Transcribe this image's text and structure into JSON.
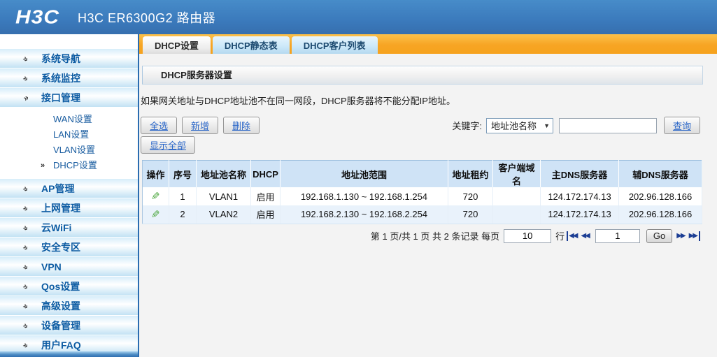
{
  "header": {
    "logo": "H3C",
    "title": "H3C ER6300G2 路由器"
  },
  "sidebar": {
    "top": [
      {
        "label": "系统导航"
      },
      {
        "label": "系统监控"
      },
      {
        "label": "接口管理"
      }
    ],
    "sub": [
      {
        "label": "WAN设置"
      },
      {
        "label": "LAN设置"
      },
      {
        "label": "VLAN设置"
      },
      {
        "label": "DHCP设置"
      }
    ],
    "bottom": [
      {
        "label": "AP管理"
      },
      {
        "label": "上网管理"
      },
      {
        "label": "云WiFi"
      },
      {
        "label": "安全专区"
      },
      {
        "label": "VPN"
      },
      {
        "label": "Qos设置"
      },
      {
        "label": "高级设置"
      },
      {
        "label": "设备管理"
      },
      {
        "label": "用户FAQ"
      }
    ]
  },
  "tabs": [
    {
      "label": "DHCP设置",
      "active": true
    },
    {
      "label": "DHCP静态表",
      "active": false
    },
    {
      "label": "DHCP客户列表",
      "active": false
    }
  ],
  "panel": {
    "section_title": "DHCP服务器设置",
    "note": "如果网关地址与DHCP地址池不在同一网段，DHCP服务器将不能分配IP地址。"
  },
  "toolbar": {
    "select_all": "全选",
    "add": "新增",
    "delete": "删除",
    "show_all": "显示全部",
    "keyword_label": "关键字:",
    "keyword_selected": "地址池名称",
    "search": "查询"
  },
  "table": {
    "headers": [
      "操作",
      "序号",
      "地址池名称",
      "DHCP",
      "地址池范围",
      "地址租约",
      "客户端域名",
      "主DNS服务器",
      "辅DNS服务器"
    ],
    "rows": [
      {
        "seq": "1",
        "pool_name": "VLAN1",
        "dhcp_status": "启用",
        "range": "192.168.1.130 ~ 192.168.1.254",
        "lease": "720",
        "client_domain": "",
        "primary_dns": "124.172.174.13",
        "secondary_dns": "202.96.128.166"
      },
      {
        "seq": "2",
        "pool_name": "VLAN2",
        "dhcp_status": "启用",
        "range": "192.168.2.130 ~ 192.168.2.254",
        "lease": "720",
        "client_domain": "",
        "primary_dns": "124.172.174.13",
        "secondary_dns": "202.96.128.166"
      }
    ]
  },
  "pagination": {
    "page_info": "第 1 页/共 1 页 共 2 条记录 每页",
    "per_page_value": "10",
    "rows_label": "行",
    "page_value": "1",
    "go_label": "Go"
  },
  "icons": {
    "nav_bullet": "»",
    "sub_active_arrow": "»",
    "dropdown_arrow": "▼",
    "edit_pencil": "✎",
    "page_prev_double": "◀◀",
    "page_next_double": "▶▶"
  },
  "colors": {
    "header_blue": "#3b7abc",
    "tab_orange": "#f7a524",
    "table_header_bg": "#cfe3f6",
    "row_alt_bg": "#e9f2fb",
    "link_blue": "#2a66c8",
    "pencil_green": "#4aa63c",
    "pagination_arrow_blue": "#1c3e94",
    "sidebar_text_blue": "#0d5ca3"
  }
}
